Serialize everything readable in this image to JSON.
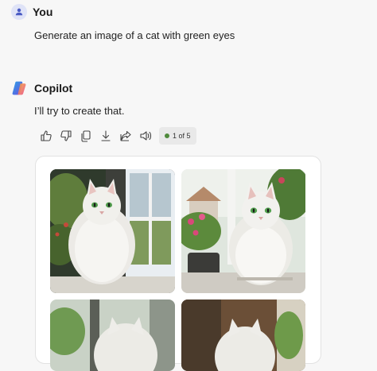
{
  "user": {
    "name": "You",
    "message": "Generate an image of a cat with green eyes"
  },
  "copilot": {
    "name": "Copilot",
    "message": "I’ll try to create that.",
    "counter": "1 of 5"
  },
  "actions": [
    "thumbs-up-icon",
    "thumbs-down-icon",
    "copy-icon",
    "download-icon",
    "share-icon",
    "speaker-icon"
  ],
  "colors": {
    "background": "#f7f7f7",
    "status_dot": "#4f8a3c"
  }
}
